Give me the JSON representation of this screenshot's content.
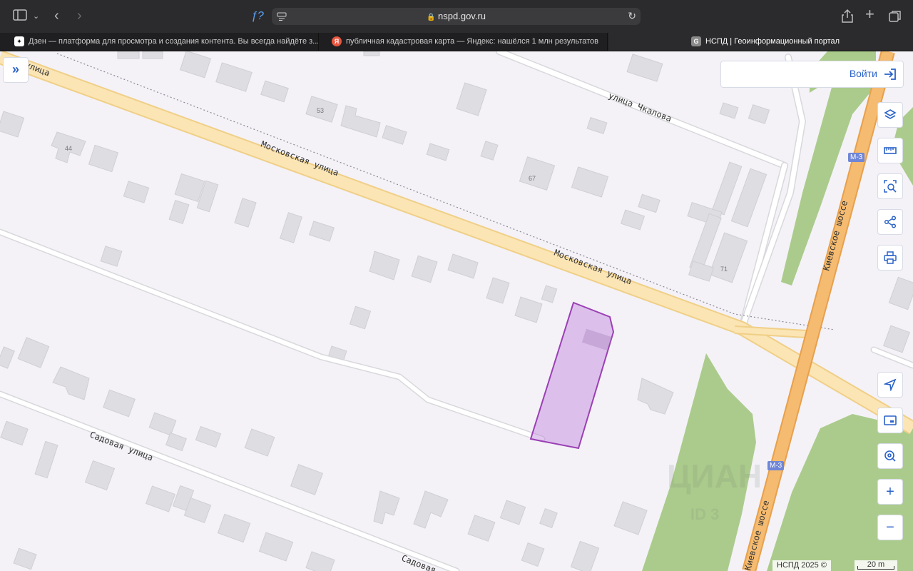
{
  "browser": {
    "url": "nspd.gov.ru",
    "reader_label": "ƒ?",
    "tabs": [
      {
        "label": "Дзен — платформа для просмотра и создания контента. Вы всегда найдёте з...",
        "icon": "dzen-icon"
      },
      {
        "label": "публичная кадастровая карта — Яндекс: нашёлся 1 млн результатов",
        "icon": "yandex-icon",
        "favicon_text": "Я"
      },
      {
        "label": "НСПД | Геоинформационный портал",
        "icon": "nspd-icon",
        "favicon_text": "G",
        "active": true
      }
    ]
  },
  "map": {
    "streets": {
      "moskovskaya_1": "Московская улица",
      "moskovskaya_2": "Московская улица",
      "moskovskaya_top": "ая улица",
      "chkalova": "улица Чкалова",
      "kievskoe_1": "Киевское шоссе",
      "kievskoe_2": "Киевское шоссе",
      "sadovaya_1": "Садовая улица",
      "sadovaya_2": "Садовая у"
    },
    "house_numbers": {
      "n53": "53",
      "n44": "44",
      "n67": "67",
      "n71": "71"
    },
    "road_shields": {
      "top": "М-3",
      "bottom": "М-3"
    },
    "selected_parcel_color": "#9b3fb5",
    "watermark": "ЦИАН",
    "watermark_id": "ID 3"
  },
  "controls": {
    "expand_icon": "»",
    "login_label": "Войти",
    "zoom_in": "+",
    "zoom_out": "−"
  },
  "footer": {
    "copyright": "НСПД 2025 ©",
    "scale_label": "20 m"
  }
}
